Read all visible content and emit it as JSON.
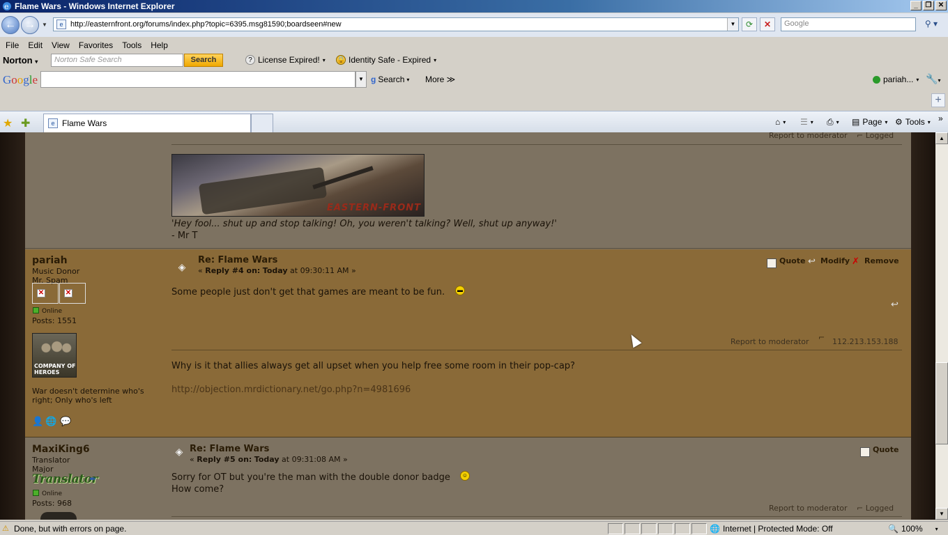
{
  "window": {
    "title": "Flame Wars - Windows Internet Explorer",
    "buttons": [
      "_",
      "❐",
      "✕"
    ]
  },
  "address_bar": {
    "url": "http://easternfront.org/forums/index.php?topic=6395.msg81590;boardseen#new",
    "search_placeholder": "Google"
  },
  "menu": [
    "File",
    "Edit",
    "View",
    "Favorites",
    "Tools",
    "Help"
  ],
  "norton": {
    "logo": "Norton",
    "search_placeholder": "Norton Safe Search",
    "search_button": "Search",
    "license": "License Expired!",
    "identity": "Identity Safe - Expired"
  },
  "google_toolbar": {
    "logo": "Google",
    "search_label": "Search",
    "more_label": "More ≫",
    "user": "pariah..."
  },
  "tab": {
    "label": "Flame Wars"
  },
  "command_bar": {
    "page_label": "Page",
    "tools_label": "Tools"
  },
  "posts": {
    "p1": {
      "report": "Report to moderator",
      "logged": "Logged",
      "banner_text": "EASTERN-FRONT",
      "sig_quote": "'Hey fool... shut up and stop talking! Oh, you weren't talking? Well, shut up anyway!'",
      "sig_author": "- Mr T"
    },
    "p2": {
      "author": "pariah",
      "group": "Music Donor",
      "rank": "Mr. Spam",
      "status": "Online",
      "posts": "Posts: 1551",
      "avatar_label": "COMPANY OF HEROES",
      "user_text": "War doesn't determine who's right; Only who's left",
      "subject": "Re: Flame Wars",
      "reply_prefix": "« ",
      "reply_num": "Reply #4 on:",
      "reply_today": "Today",
      "reply_time": " at 09:30:11 AM »",
      "quote": "Quote",
      "modify": "Modify",
      "remove": "Remove",
      "body": "Some people just don't get that games are meant to be fun.",
      "report": "Report to moderator",
      "ip": "112.213.153.188",
      "sig_text": "Why is it that allies always get all upset when you help free some room in their pop-cap?",
      "sig_link": "http://objection.mrdictionary.net/go.php?n=4981696"
    },
    "p3": {
      "author": "MaxiKing6",
      "group": "Translator",
      "rank": "Major",
      "badge": "Translator",
      "status": "Online",
      "posts": "Posts: 968",
      "subject": "Re: Flame Wars",
      "reply_prefix": "« ",
      "reply_num": "Reply #5 on:",
      "reply_today": "Today",
      "reply_time": " at 09:31:08 AM »",
      "quote": "Quote",
      "body_line1": "Sorry for OT but you're the man with the double donor badge",
      "body_line2": "How come?",
      "report": "Report to moderator",
      "logged": "Logged"
    }
  },
  "status_bar": {
    "text": "Done, but with errors on page.",
    "zone": "Internet | Protected Mode: Off",
    "zoom": "100%"
  }
}
